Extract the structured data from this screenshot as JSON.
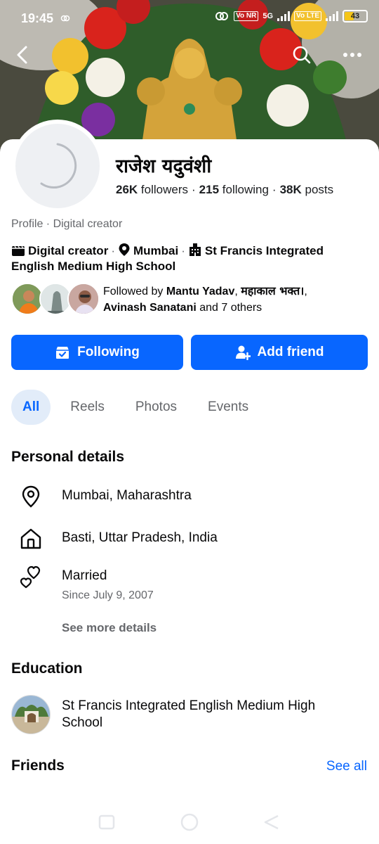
{
  "status_bar": {
    "time": "19:45",
    "network_label_1": "Vo NR",
    "network_label_2": "5G",
    "network_label_3": "Vo LTE",
    "battery": "43",
    "battery_level": 0.43
  },
  "profile": {
    "name": "राजेश यदुवंशी",
    "followers_count": "26K",
    "followers_label": " followers",
    "following_count": "215",
    "following_label": " following",
    "posts_count": "38K",
    "posts_label": " posts",
    "category_line": "Profile · Digital creator"
  },
  "intro": {
    "creator_label": "Digital creator",
    "location_label": "Mumbai",
    "school_label": "St Francis Integrated English Medium High School"
  },
  "mutual": {
    "prefix": "Followed by ",
    "name1": "Mantu Yadav",
    "comma": ", ",
    "name2": "महाकाल भक्त।",
    "comma2": ",",
    "name3": "Avinash Sanatani",
    "suffix": " and 7 others"
  },
  "actions": {
    "following_label": "Following",
    "add_friend_label": "Add friend"
  },
  "tabs": [
    {
      "label": "All"
    },
    {
      "label": "Reels"
    },
    {
      "label": "Photos"
    },
    {
      "label": "Events"
    }
  ],
  "personal_details": {
    "title": "Personal details",
    "current_city": "Mumbai, Maharashtra",
    "hometown": "Basti, Uttar Pradesh, India",
    "relationship": "Married",
    "relationship_since": "Since July 9, 2007",
    "see_more": "See more details"
  },
  "education": {
    "title": "Education",
    "school": "St Francis Integrated English Medium High School"
  },
  "friends": {
    "title": "Friends",
    "see_all": "See all"
  },
  "colors": {
    "accent": "#0866ff",
    "tab_active_bg": "#e2ecf9",
    "secondary_text": "#65676b"
  },
  "icons": [
    "back-arrow-icon",
    "search-icon",
    "more-icon",
    "clapperboard-icon",
    "location-pin-icon",
    "building-icon",
    "following-check-icon",
    "add-person-icon",
    "home-icon",
    "hearts-icon"
  ]
}
